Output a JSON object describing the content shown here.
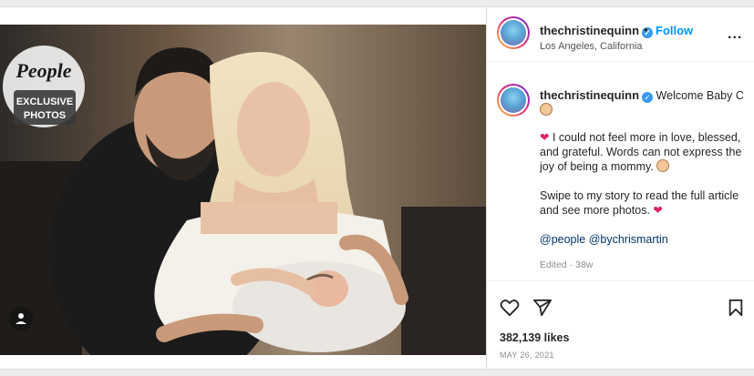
{
  "header": {
    "username": "thechristinequinn",
    "separator": "•",
    "follow_label": "Follow",
    "location": "Los Angeles, California",
    "more_label": "..."
  },
  "photo": {
    "brand": "People",
    "tag_line1": "EXCLUSIVE",
    "tag_line2": "PHOTOS"
  },
  "caption": {
    "username": "thechristinequinn",
    "title": "Welcome Baby C",
    "line2": "I could not feel more in love, blessed, and grateful. Words can not express the joy of being a mommy.",
    "line3": "Swipe to my story to read the full article and see more photos.",
    "mention1": "@people",
    "mention2": "@bychrismartin",
    "edited": "Edited · 38w"
  },
  "actions": {
    "likes": "382,139 likes",
    "date": "MAY 26, 2021"
  },
  "icons": {
    "verified": "verified-badge-icon",
    "heart": "heart-outline-icon",
    "share": "share-paper-plane-icon",
    "save": "bookmark-icon",
    "user_tag": "user-tag-icon",
    "heart_emoji": "red-heart-emoji",
    "baby_emoji": "baby-emoji"
  },
  "colors": {
    "link": "#0095f6",
    "mention": "#00376b",
    "verified": "#3897f0",
    "heart": "#e0245e"
  }
}
